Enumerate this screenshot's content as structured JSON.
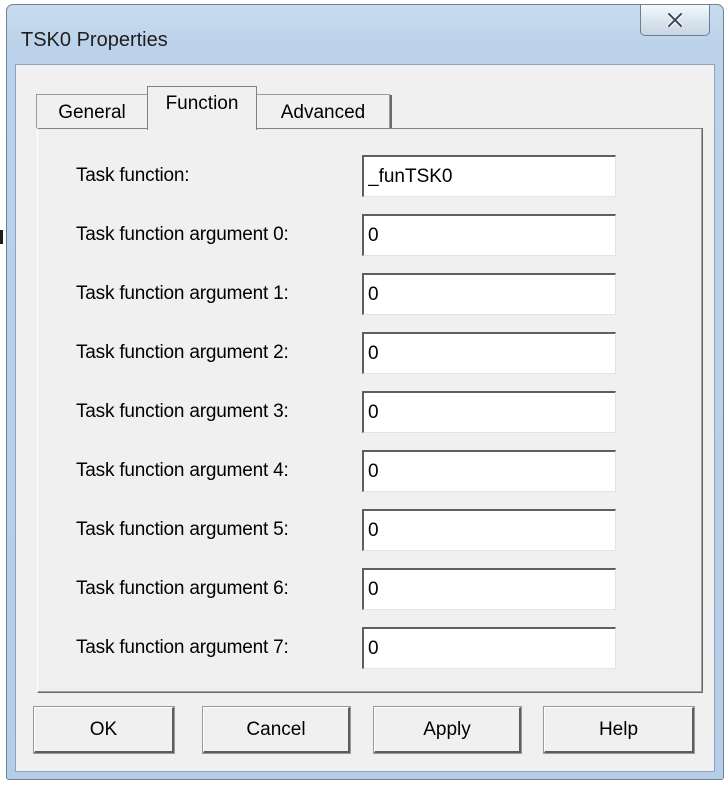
{
  "window": {
    "title": "TSK0 Properties",
    "close_icon": "close-x-icon"
  },
  "tabs": [
    {
      "label": "General",
      "selected": false
    },
    {
      "label": "Function",
      "selected": true
    },
    {
      "label": "Advanced",
      "selected": false
    }
  ],
  "fields": [
    {
      "label": "Task function:",
      "value": "_funTSK0"
    },
    {
      "label": "Task function argument 0:",
      "value": "0"
    },
    {
      "label": "Task function argument 1:",
      "value": "0"
    },
    {
      "label": "Task function argument 2:",
      "value": "0"
    },
    {
      "label": "Task function argument 3:",
      "value": "0"
    },
    {
      "label": "Task function argument 4:",
      "value": "0"
    },
    {
      "label": "Task function argument 5:",
      "value": "0"
    },
    {
      "label": "Task function argument 6:",
      "value": "0"
    },
    {
      "label": "Task function argument 7:",
      "value": "0"
    }
  ],
  "buttons": {
    "ok": "OK",
    "cancel": "Cancel",
    "apply": "Apply",
    "help": "Help"
  },
  "colors": {
    "frame": "#b9d1ea",
    "client": "#f0f0f0"
  }
}
